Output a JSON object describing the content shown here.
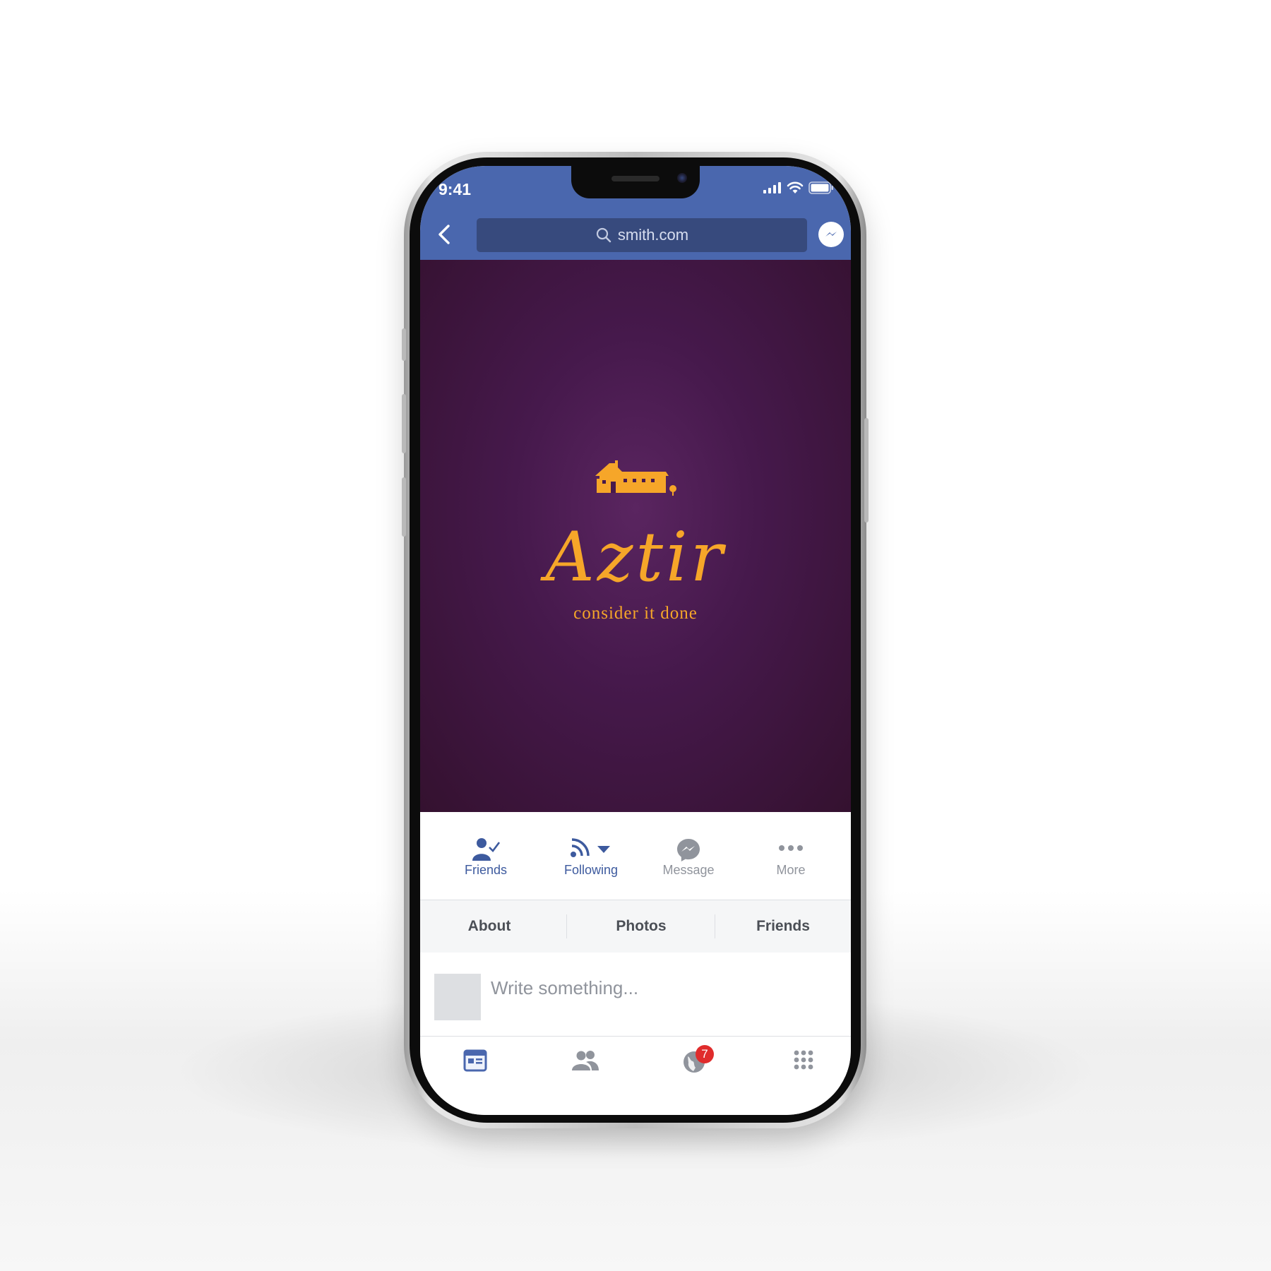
{
  "status_bar": {
    "time": "9:41"
  },
  "nav": {
    "search_text": "smith.com"
  },
  "cover": {
    "brand_name": "Aztir",
    "tagline": "consider it done"
  },
  "actions": [
    {
      "label": "Friends",
      "icon": "friend-check-icon",
      "color": "#3d5a9e"
    },
    {
      "label": "Following",
      "icon": "rss-icon",
      "color": "#3d5a9e"
    },
    {
      "label": "Message",
      "icon": "messenger-icon",
      "color": "#90949c"
    },
    {
      "label": "More",
      "icon": "more-dots-icon",
      "color": "#90949c"
    }
  ],
  "tabs": [
    "About",
    "Photos",
    "Friends"
  ],
  "composer": {
    "placeholder": "Write something..."
  },
  "bottom_nav": {
    "items": [
      "news-feed-icon",
      "friends-icon",
      "notifications-globe-icon",
      "menu-grid-icon"
    ],
    "notifications_badge": "7"
  },
  "colors": {
    "brand_blue": "#4a67ae",
    "search_bg": "#374a7d",
    "cover_purple": "#46194c",
    "logo_orange": "#f6a629",
    "badge_red": "#e02c2c"
  }
}
